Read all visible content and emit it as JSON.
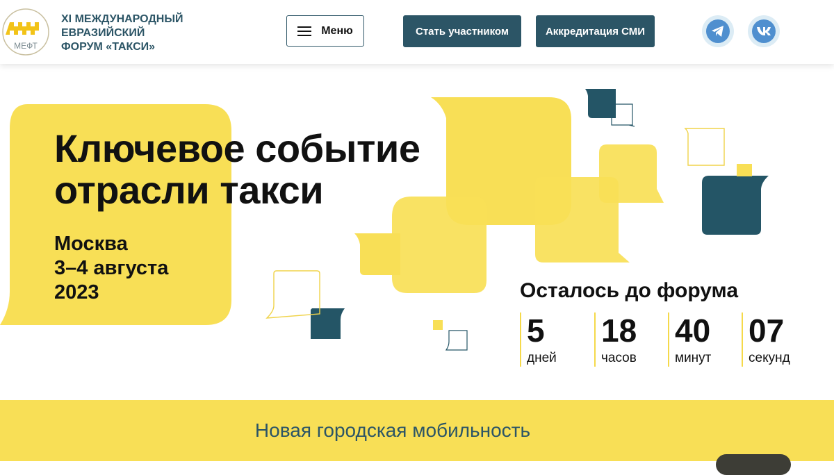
{
  "colors": {
    "accent_yellow": "#f8df56",
    "brand_dark": "#2c5566",
    "text": "#111111"
  },
  "header": {
    "logo": {
      "abbr": "МЕФТ",
      "icon": "taxi-checker-logo"
    },
    "title_lines": [
      "XI МЕЖДУНАРОДНЫЙ",
      "ЕВРАЗИЙСКИЙ",
      "ФОРУМ «ТАКСИ»"
    ],
    "menu_label": "Меню",
    "menu_icon": "hamburger-icon",
    "participant_label": "Стать участником",
    "media_label": "Аккредитация СМИ",
    "social": [
      "telegram-icon",
      "vk-icon"
    ]
  },
  "hero": {
    "title_lines": [
      "Ключевое событие",
      "отрасли такси"
    ],
    "city": "Москва",
    "dates": "3–4 августа",
    "year": "2023"
  },
  "countdown": {
    "label": "Осталось до форума",
    "days": {
      "value": "5",
      "unit": "дней"
    },
    "hours": {
      "value": "18",
      "unit": "часов"
    },
    "minutes": {
      "value": "40",
      "unit": "минут"
    },
    "seconds": {
      "value": "07",
      "unit": "секунд"
    }
  },
  "banner": {
    "text": "Новая городская мобильность"
  }
}
